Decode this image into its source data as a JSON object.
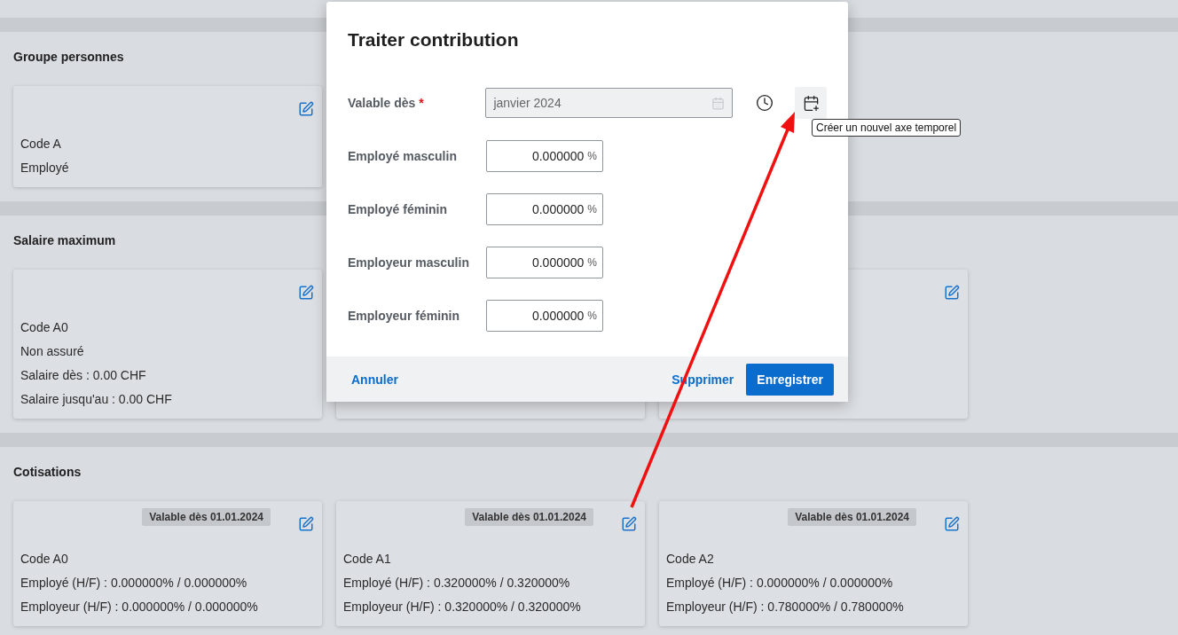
{
  "sections": [
    {
      "title": "Groupe personnes",
      "cards": [
        {
          "kind": "editable",
          "lines": [
            "Code A",
            "Employé"
          ]
        }
      ]
    },
    {
      "title": "Salaire maximum",
      "cards": [
        {
          "kind": "editable",
          "lines": [
            "Code A0",
            "Non assuré",
            "Salaire dès : 0.00 CHF",
            "Salaire jusqu'au : 0.00 CHF"
          ]
        },
        {
          "kind": "covered"
        },
        {
          "kind": "editable"
        }
      ]
    },
    {
      "title": "Cotisations",
      "cards": [
        {
          "kind": "editable",
          "badge": "Valable dès 01.01.2024",
          "lines": [
            "Code A0",
            "Employé (H/F) : 0.000000% / 0.000000%",
            "Employeur (H/F) : 0.000000% / 0.000000%"
          ]
        },
        {
          "kind": "editable",
          "badge": "Valable dès 01.01.2024",
          "lines": [
            "Code A1",
            "Employé (H/F) : 0.320000% / 0.320000%",
            "Employeur (H/F) : 0.320000% / 0.320000%"
          ]
        },
        {
          "kind": "editable",
          "badge": "Valable dès 01.01.2024",
          "lines": [
            "Code A2",
            "Employé (H/F) : 0.000000% / 0.000000%",
            "Employeur (H/F) : 0.780000% / 0.780000%"
          ]
        }
      ]
    }
  ],
  "modal": {
    "title": "Traiter contribution",
    "fields": [
      {
        "kind": "date",
        "label": "Valable dès",
        "required_mark": "*",
        "value": "janvier 2024",
        "disabled": true
      },
      {
        "kind": "percent",
        "label": "Employé masculin",
        "value": "0.000000",
        "unit": "%"
      },
      {
        "kind": "percent",
        "label": "Employé féminin",
        "value": "0.000000",
        "unit": "%"
      },
      {
        "kind": "percent",
        "label": "Employeur masculin",
        "value": "0.000000",
        "unit": "%"
      },
      {
        "kind": "percent",
        "label": "Employeur féminin",
        "value": "0.000000",
        "unit": "%"
      }
    ],
    "tooltip": "Créer un nouvel axe temporel",
    "footer": {
      "cancel": "Annuler",
      "delete": "Supprimer",
      "save": "Enregistrer"
    }
  }
}
